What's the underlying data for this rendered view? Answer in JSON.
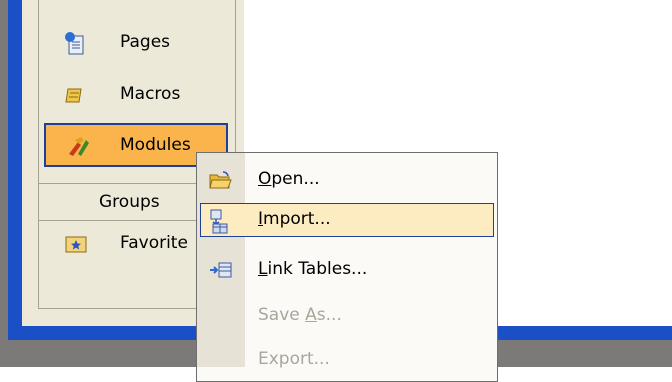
{
  "object_list": {
    "items": [
      {
        "label": "Pages",
        "icon": "page-icon"
      },
      {
        "label": "Macros",
        "icon": "macro-scroll-icon"
      },
      {
        "label": "Modules",
        "icon": "module-icon",
        "selected": true
      }
    ],
    "groups_header": "Groups",
    "favorites_label": "Favorite"
  },
  "context_menu": {
    "items": [
      {
        "mnemonic": "O",
        "rest": "pen...",
        "icon": "open-folder-icon",
        "enabled": true
      },
      {
        "mnemonic": "I",
        "rest": "mport...",
        "icon": "import-icon",
        "enabled": true,
        "highlighted": true
      },
      {
        "mnemonic": "L",
        "rest": "ink Tables...",
        "icon": "link-tables-icon",
        "enabled": true
      },
      {
        "pre": "Save ",
        "mnemonic": "A",
        "rest": "s...",
        "enabled": false
      },
      {
        "label": "Export...",
        "enabled": false
      }
    ]
  },
  "colors": {
    "frame_blue": "#1b4fc6",
    "selection_orange": "#fbb44c",
    "menu_highlight": "#fdecc1",
    "panel_beige": "#ece9d8"
  }
}
